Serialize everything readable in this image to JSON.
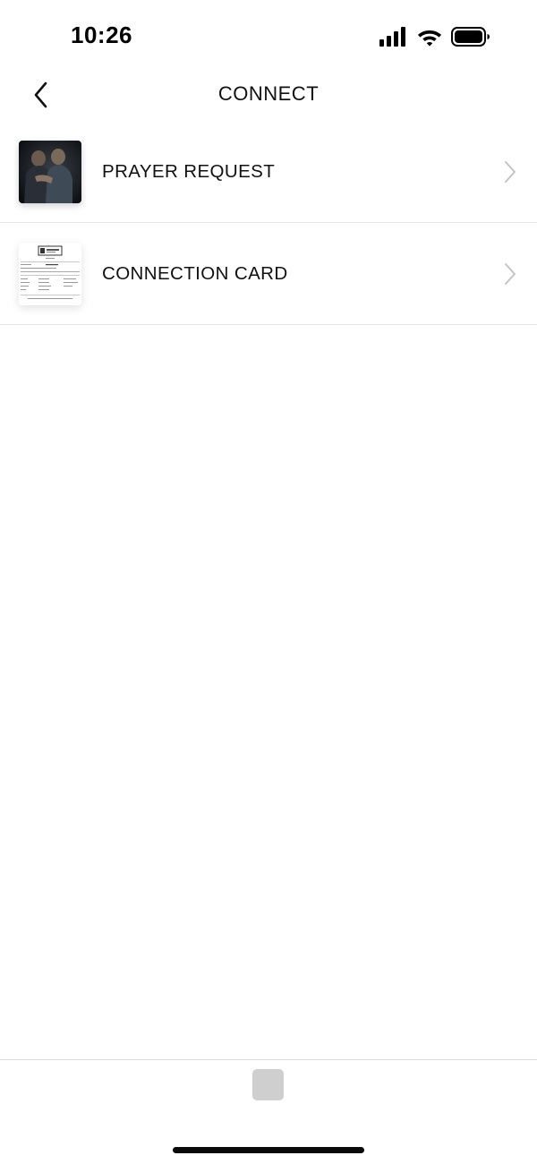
{
  "status_bar": {
    "time": "10:26",
    "icons": [
      "signal-icon",
      "wifi-icon",
      "battery-icon"
    ]
  },
  "nav": {
    "title": "CONNECT",
    "back_icon": "chevron-left-icon"
  },
  "list": {
    "items": [
      {
        "label": "PRAYER REQUEST",
        "thumbnail": "photo-thumbnail",
        "icon": "chevron-right-icon"
      },
      {
        "label": "CONNECTION CARD",
        "thumbnail": "document-thumbnail",
        "icon": "chevron-right-icon"
      }
    ]
  },
  "colors": {
    "text": "#111111",
    "divider": "#e3e3e3",
    "chevron": "#c4c4c4",
    "tab_placeholder": "#cfcfcf"
  }
}
